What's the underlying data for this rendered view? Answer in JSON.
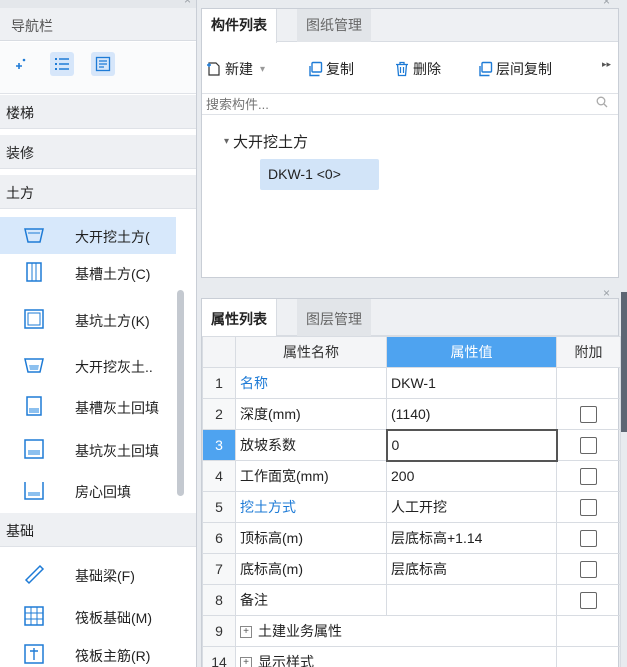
{
  "nav": {
    "title": "导航栏",
    "categories": {
      "stairs": "楼梯",
      "decor": "装修",
      "earthwork": "土方",
      "foundation": "基础"
    },
    "items": [
      {
        "label": "大开挖土方(",
        "icon": "excavation-icon"
      },
      {
        "label": "基槽土方(C)",
        "icon": "trench-icon"
      },
      {
        "label": "基坑土方(K)",
        "icon": "pit-icon"
      },
      {
        "label": "大开挖灰土..",
        "icon": "lime-soil-excavation-icon"
      },
      {
        "label": "基槽灰土回填",
        "icon": "trench-backfill-icon"
      },
      {
        "label": "基坑灰土回填",
        "icon": "pit-backfill-icon"
      },
      {
        "label": "房心回填",
        "icon": "room-backfill-icon"
      }
    ],
    "foundation_items": [
      {
        "label": "基础梁(F)",
        "icon": "foundation-beam-icon"
      },
      {
        "label": "筏板基础(M)",
        "icon": "raft-foundation-icon"
      },
      {
        "label": "筏板主筋(R)",
        "icon": "raft-rebar-icon"
      }
    ]
  },
  "component_pane": {
    "tabs": [
      "构件列表",
      "图纸管理"
    ],
    "toolbar": {
      "new": "新建",
      "copy": "复制",
      "delete": "删除",
      "floor_copy": "层间复制"
    },
    "search_placeholder": "搜索构件...",
    "tree": {
      "parent": "大开挖土方",
      "child": "DKW-1 <0>"
    }
  },
  "props_pane": {
    "tabs": [
      "属性列表",
      "图层管理"
    ],
    "columns": [
      "属性名称",
      "属性值",
      "附加"
    ],
    "rows": [
      {
        "idx": "1",
        "name": "名称",
        "value": "DKW-1"
      },
      {
        "idx": "2",
        "name": "深度(mm)",
        "value": "(1140)"
      },
      {
        "idx": "3",
        "name": "放坡系数",
        "value": "0"
      },
      {
        "idx": "4",
        "name": "工作面宽(mm)",
        "value": "200"
      },
      {
        "idx": "5",
        "name": "挖土方式",
        "value": "人工开挖"
      },
      {
        "idx": "6",
        "name": "顶标高(m)",
        "value": "层底标高+1.14"
      },
      {
        "idx": "7",
        "name": "底标高(m)",
        "value": "层底标高"
      },
      {
        "idx": "8",
        "name": "备注",
        "value": ""
      },
      {
        "idx": "9",
        "name": "土建业务属性",
        "value": ""
      },
      {
        "idx": "14",
        "name": "显示样式",
        "value": ""
      }
    ]
  },
  "colors": {
    "accent": "#1e7bd6",
    "selected_header": "#4ea3f0",
    "selection_bg": "#d7e8fb"
  }
}
